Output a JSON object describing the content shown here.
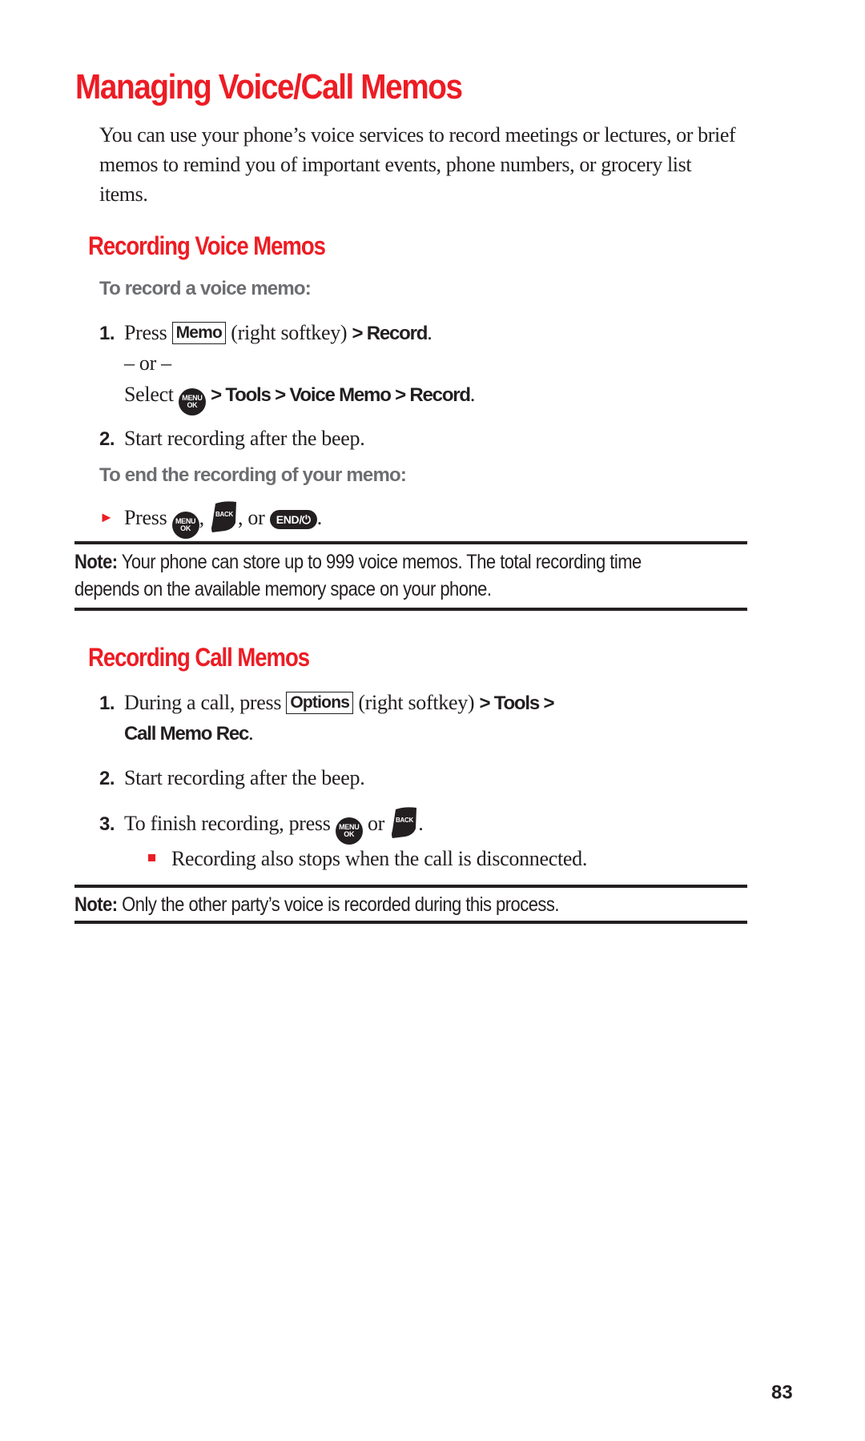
{
  "page": {
    "title": "Managing Voice/Call Memos",
    "intro": "You can use your phone’s voice services to record meetings or lectures, or brief memos to remind you of important events, phone numbers, or grocery list items.",
    "page_number": "83",
    "accent_color": "#ed1c24"
  },
  "voice_section": {
    "heading": "Recording Voice Memos",
    "subheading_record": "To record a voice memo:",
    "step1": {
      "num": "1.",
      "press": "Press",
      "softkey": "Memo",
      "softkey_note": "(right softkey)",
      "path": "> Record",
      "end": "."
    },
    "or_text": "– or –",
    "step1_alt": {
      "select": "Select",
      "menu_icon_top": "MENU",
      "menu_icon_bottom": "OK",
      "path": "> Tools > Voice Memo > Record",
      "end": "."
    },
    "step2": {
      "num": "2.",
      "text": "Start recording after the beep."
    },
    "subheading_end": "To end the recording of your memo:",
    "end_step": {
      "press": "Press",
      "comma": ",",
      "back_label": "BACK",
      "or": ", or",
      "end_key_label": "END/⏻",
      "end": "."
    },
    "note": {
      "label": "Note:",
      "text": " Your phone can store up to 999 voice memos. The total recording time depends on the available memory space on your phone."
    }
  },
  "call_section": {
    "heading": "Recording Call Memos",
    "step1": {
      "num": "1.",
      "text": "During a call, press",
      "softkey": "Options",
      "softkey_note": "(right softkey)",
      "path_a": "> Tools >",
      "path_b": "Call Memo Rec",
      "end": "."
    },
    "step2": {
      "num": "2.",
      "text": "Start recording after the beep."
    },
    "step3": {
      "num": "3.",
      "text": "To finish recording, press",
      "or": "or",
      "back_label": "BACK",
      "end": "."
    },
    "bullet": "Recording also stops when the call is disconnected.",
    "note": {
      "label": "Note:",
      "text": " Only the other party’s voice is recorded during this process."
    }
  }
}
